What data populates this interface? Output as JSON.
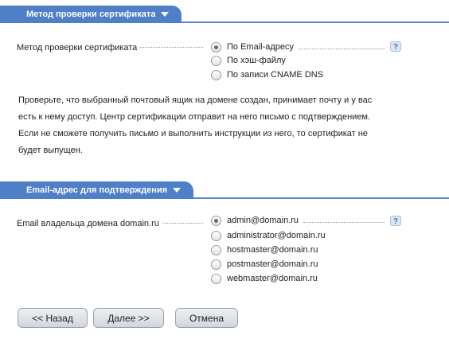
{
  "section1": {
    "title": "Метод проверки сертификата",
    "field_label": "Метод проверки сертификата",
    "options": [
      {
        "label": "По Email-адресу",
        "checked": true
      },
      {
        "label": "По хэш-файлу",
        "checked": false
      },
      {
        "label": "По записи CNAME DNS",
        "checked": false
      }
    ],
    "help": "?"
  },
  "description": [
    "Проверьте, что выбранный почтовый ящик на домене создан, принимает почту и у вас",
    "есть к нему доступ. Центр сертификации отправит на него письмо с подтверждением.",
    "Если не сможете получить письмо и выполнить инструкции из него, то сертификат не",
    "будет выпущен."
  ],
  "section2": {
    "title": "Email-адрес для подтверждения",
    "field_label": "Email владельца домена domain.ru",
    "options": [
      {
        "label": "admin@domain.ru",
        "checked": true
      },
      {
        "label": "administrator@domain.ru",
        "checked": false
      },
      {
        "label": "hostmaster@domain.ru",
        "checked": false
      },
      {
        "label": "postmaster@domain.ru",
        "checked": false
      },
      {
        "label": "webmaster@domain.ru",
        "checked": false
      }
    ],
    "help": "?"
  },
  "buttons": {
    "back": "<< Назад",
    "next": "Далее >>",
    "cancel": "Отмена"
  }
}
